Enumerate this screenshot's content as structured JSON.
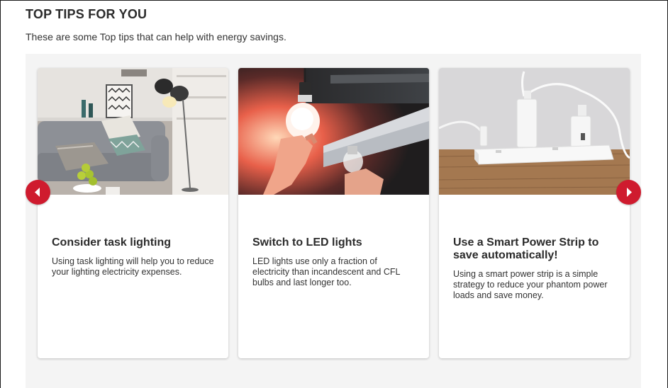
{
  "section": {
    "title": "TOP TIPS FOR YOU",
    "subtitle": "These are some Top tips that can help with energy savings."
  },
  "carousel": {
    "prev_icon": "chevron-left-icon",
    "next_icon": "chevron-right-icon",
    "accent_color": "#cf1b2e",
    "cards": [
      {
        "image": "living-room-task-lamp-photo",
        "title": "Consider task lighting",
        "text": "Using task lighting will help you to reduce your lighting electricity expenses."
      },
      {
        "image": "led-bulb-hands-photo",
        "title": "Switch to LED lights",
        "text": "LED lights use only a fraction of electricity than incandescent and CFL bulbs and last longer too."
      },
      {
        "image": "smart-power-strip-photo",
        "title": "Use a Smart Power Strip to save automatically!",
        "text": "Using a smart power strip is a simple strategy to reduce your phantom power loads and save money."
      }
    ]
  }
}
